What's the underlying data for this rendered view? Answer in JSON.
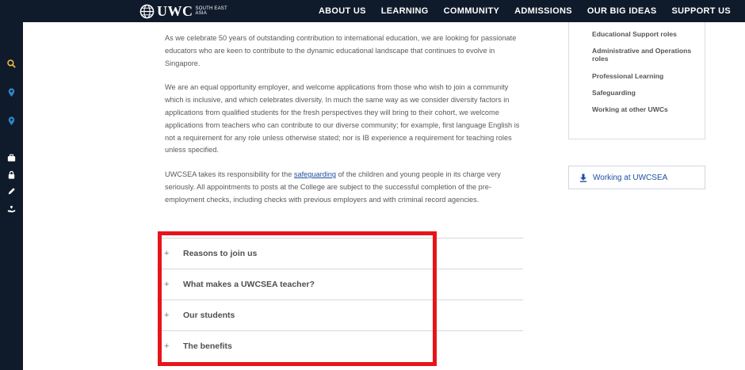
{
  "header": {
    "logo_main": "UWC",
    "logo_sub_line1": "SOUTH EAST",
    "logo_sub_line2": "ASIA",
    "nav": [
      "ABOUT US",
      "LEARNING",
      "COMMUNITY",
      "ADMISSIONS",
      "OUR BIG IDEAS",
      "SUPPORT US"
    ]
  },
  "rail_icons": [
    "search-icon",
    "location-pin-icon",
    "location-pin-icon",
    "briefcase-icon",
    "lock-icon",
    "pencil-icon",
    "hand-heart-icon"
  ],
  "content": {
    "para1": "As we celebrate 50 years of outstanding contribution to international education, we are looking for passionate educators who are keen to contribute to the dynamic educational landscape that continues to evolve in Singapore.",
    "para2": "We are an equal opportunity employer, and welcome applications from those who wish to join a community which is inclusive, and which celebrates diversity. In much the same way as we consider diversity factors in applications from qualified students for the fresh perspectives they will bring to their cohort, we welcome applications from teachers who can contribute to our diverse community; for example, first language English is not a requirement for any role unless otherwise stated; nor is IB experience a requirement for teaching roles unless specified.",
    "para3_before": "UWCSEA takes its responsibility for the ",
    "para3_link": "safeguarding",
    "para3_after": " of the children and young people in its charge very seriously. All appointments to posts at the College are subject to the successful completion of the pre-employment checks, including checks with previous employers and with criminal record agencies."
  },
  "accordion": {
    "plus": "+",
    "items": [
      "Reasons to join us",
      "What makes a UWCSEA teacher?",
      "Our students",
      "The benefits"
    ]
  },
  "sidebar": {
    "links": [
      "Educational Support roles",
      "Administrative and Operations roles",
      "Professional Learning",
      "Safeguarding",
      "Working at other UWCs"
    ],
    "download_label": "Working at UWCSEA"
  },
  "colors": {
    "nav_bg": "#0f1a2b",
    "accent_gold": "#e8b53a",
    "accent_blue": "#2e86c8",
    "link_blue": "#1f4fa0",
    "highlight_red": "#e8141b"
  }
}
